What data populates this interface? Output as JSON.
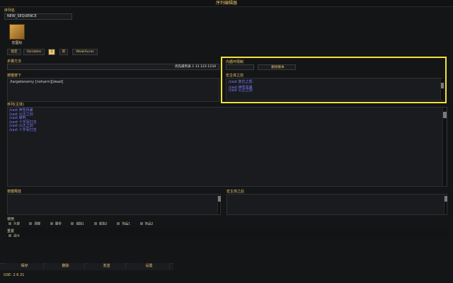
{
  "window": {
    "title": "序列编辑器"
  },
  "sequence": {
    "name_label": "序列名",
    "name_value": "NEW_SEQUENCE",
    "icon_label": "宏图标"
  },
  "tabs": [
    {
      "label": "锁定"
    },
    {
      "label": "Variables"
    },
    {
      "label": "1"
    },
    {
      "label": "新"
    },
    {
      "label": "WeakAuras"
    }
  ],
  "step_function": {
    "label": "步骤方法",
    "value": "优先级列表 1 12 123 1234"
  },
  "inner_loop": {
    "label": "内循环限制",
    "delete_version": "删除版本"
  },
  "keypress": {
    "label": "按键按下",
    "text": "/targetenemy [noharm][dead]"
  },
  "pre_macro": {
    "label": "宏主体之前",
    "lines": [
      "/cast 复仇之怒",
      "/cast 神圣风暴",
      "/cast 公正之剑"
    ]
  },
  "macro_body": {
    "label": "序列(主体)",
    "lines": [
      "/cast 神圣风暴",
      "/cast 公正之剑",
      "/cast 审判",
      "/cast 十字军打击",
      "/cast 公正之剑",
      "/cast 十字军打击"
    ]
  },
  "keyrelease": {
    "label": "按键释放"
  },
  "post_macro": {
    "label": "宏主体之后"
  },
  "use": {
    "label": "使用",
    "items": [
      "头部",
      "颈部",
      "腰带",
      "戒指1",
      "戒指2",
      "饰品1",
      "饰品2"
    ]
  },
  "reset": {
    "label": "重置",
    "items": [
      "战斗"
    ]
  },
  "buttons": {
    "save": "保存",
    "delete": "删除",
    "send": "发送",
    "settings": "设置"
  },
  "version": "GSE: 2.6.31"
}
